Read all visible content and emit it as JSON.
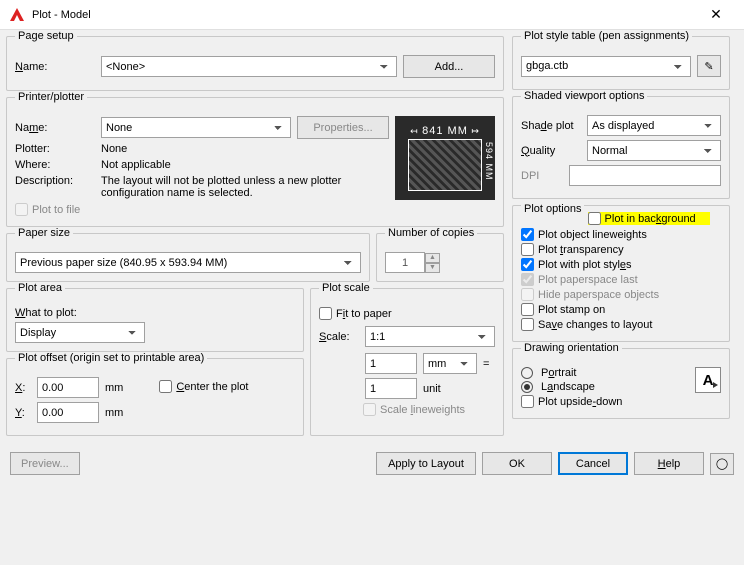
{
  "window": {
    "title": "Plot - Model"
  },
  "pageSetup": {
    "legend": "Page setup",
    "nameLabel": "Name:",
    "nameValue": "<None>",
    "addBtn": "Add..."
  },
  "printer": {
    "legend": "Printer/plotter",
    "nameLabel": "Name:",
    "nameValue": "None",
    "propertiesBtn": "Properties...",
    "plotterLabel": "Plotter:",
    "plotterValue": "None",
    "whereLabel": "Where:",
    "whereValue": "Not applicable",
    "descLabel": "Description:",
    "descValue": "The layout will not be plotted unless a new plotter configuration name is selected.",
    "plotToFile": "Plot to file",
    "previewW": "841 MM",
    "previewH": "594 MM"
  },
  "paperSize": {
    "legend": "Paper size",
    "value": "Previous paper size (840.95 x 593.94 MM)"
  },
  "copies": {
    "legend": "Number of copies",
    "value": "1"
  },
  "plotArea": {
    "legend": "Plot area",
    "whatLabel": "What to plot:",
    "value": "Display"
  },
  "plotScale": {
    "legend": "Plot scale",
    "fitToPaper": "Fit to paper",
    "scaleLabel": "Scale:",
    "scaleValue": "1:1",
    "num1": "1",
    "unit1": "mm",
    "num2": "1",
    "unit2": "unit",
    "scaleLw": "Scale lineweights"
  },
  "plotOffset": {
    "legend": "Plot offset (origin set to printable area)",
    "xLabel": "X:",
    "xValue": "0.00",
    "yLabel": "Y:",
    "yValue": "0.00",
    "mm": "mm",
    "center": "Center the plot"
  },
  "styleTable": {
    "legend": "Plot style table (pen assignments)",
    "value": "gbga.ctb"
  },
  "shaded": {
    "legend": "Shaded viewport options",
    "shadeLabel": "Shade plot",
    "shadeValue": "As displayed",
    "qualityLabel": "Quality",
    "qualityValue": "Normal",
    "dpiLabel": "DPI",
    "dpiValue": ""
  },
  "options": {
    "legend": "Plot options",
    "bg": "Plot in background",
    "lw": "Plot object lineweights",
    "tr": "Plot transparency",
    "ps": "Plot with plot styles",
    "pl": "Plot paperspace last",
    "hide": "Hide paperspace objects",
    "stamp": "Plot stamp on",
    "save": "Save changes to layout"
  },
  "orientation": {
    "legend": "Drawing orientation",
    "portrait": "Portrait",
    "landscape": "Landscape",
    "upside": "Plot upside-down"
  },
  "footer": {
    "preview": "Preview...",
    "apply": "Apply to Layout",
    "ok": "OK",
    "cancel": "Cancel",
    "help": "Help"
  }
}
